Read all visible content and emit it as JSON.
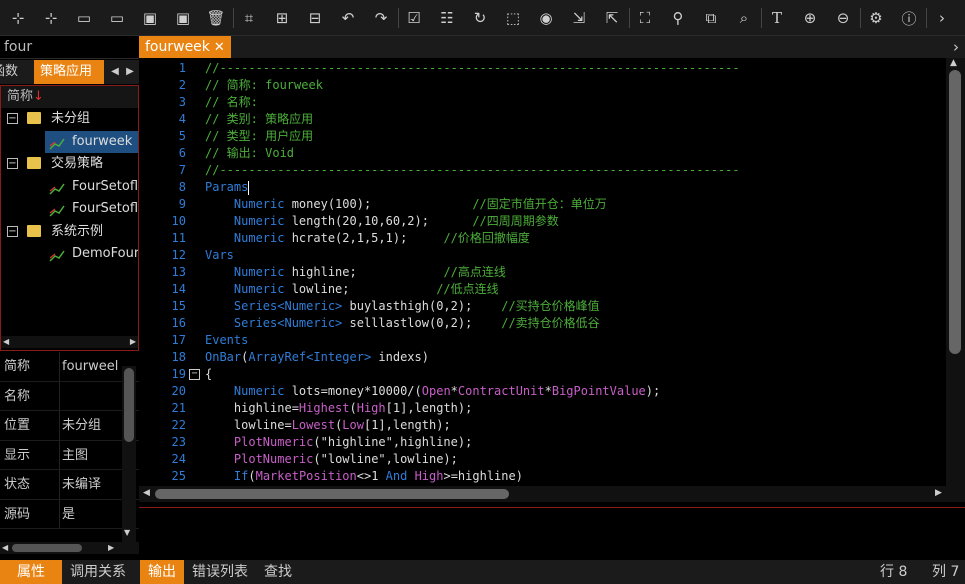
{
  "toolbar": {
    "buttons": [
      "add-node-icon",
      "add-child-icon",
      "folder-icon",
      "open-folder-icon",
      "save-icon",
      "save-all-icon",
      "delete-icon",
      "crop-icon",
      "add-box-icon",
      "copy-box-icon",
      "undo-icon",
      "redo-icon",
      "check-icon",
      "checklist-icon",
      "refresh-icon",
      "selection-icon",
      "record-icon",
      "export-icon",
      "external-icon",
      "fullscreen-icon",
      "search-icon",
      "replace-icon",
      "find-window-icon",
      "text-icon",
      "zoom-in-icon",
      "zoom-out-icon",
      "settings-icon",
      "info-icon",
      "next-icon"
    ]
  },
  "left_panel": {
    "search_value": "four",
    "tabs": [
      "函数",
      "策略应用"
    ],
    "tree_header": "简称",
    "tree": [
      {
        "type": "group",
        "label": "未分组"
      },
      {
        "type": "item",
        "label": "fourweek",
        "selected": true
      },
      {
        "type": "group",
        "label": "交易策略"
      },
      {
        "type": "item",
        "label": "FourSetofl"
      },
      {
        "type": "item",
        "label": "FourSetofl"
      },
      {
        "type": "group",
        "label": "系统示例"
      },
      {
        "type": "item",
        "label": "DemoFour"
      }
    ],
    "props": [
      {
        "k": "简称",
        "v": "fourweel"
      },
      {
        "k": "名称",
        "v": ""
      },
      {
        "k": "位置",
        "v": "未分组"
      },
      {
        "k": "显示",
        "v": "主图"
      },
      {
        "k": "状态",
        "v": "未编译"
      },
      {
        "k": "源码",
        "v": "是"
      }
    ]
  },
  "editor": {
    "tab_label": "fourweek",
    "lines": [
      [
        [
          "c-com",
          "//------------------------------------------------------------------------"
        ]
      ],
      [
        [
          "c-com",
          "// 简称: fourweek"
        ]
      ],
      [
        [
          "c-com",
          "// 名称:"
        ]
      ],
      [
        [
          "c-com",
          "// 类别: 策略应用"
        ]
      ],
      [
        [
          "c-com",
          "// 类型: 用户应用"
        ]
      ],
      [
        [
          "c-com",
          "// 输出: Void"
        ]
      ],
      [
        [
          "c-com",
          "//------------------------------------------------------------------------"
        ]
      ],
      [
        [
          "c-kw",
          "Params"
        ],
        [
          "cursor",
          ""
        ]
      ],
      [
        [
          "c-tx",
          "    "
        ],
        [
          "c-kw",
          "Numeric"
        ],
        [
          "c-tx",
          " money(100);              "
        ],
        [
          "c-com",
          "//固定市值开仓：单位万"
        ]
      ],
      [
        [
          "c-tx",
          "    "
        ],
        [
          "c-kw",
          "Numeric"
        ],
        [
          "c-tx",
          " length(20,10,60,2);      "
        ],
        [
          "c-com",
          "//四周周期参数"
        ]
      ],
      [
        [
          "c-tx",
          "    "
        ],
        [
          "c-kw",
          "Numeric"
        ],
        [
          "c-tx",
          " hcrate(2,1,5,1);     "
        ],
        [
          "c-com",
          "//价格回撤幅度"
        ]
      ],
      [
        [
          "c-kw",
          "Vars"
        ]
      ],
      [
        [
          "c-tx",
          "    "
        ],
        [
          "c-kw",
          "Numeric"
        ],
        [
          "c-tx",
          " highline;            "
        ],
        [
          "c-com",
          "//高点连线"
        ]
      ],
      [
        [
          "c-tx",
          "    "
        ],
        [
          "c-kw",
          "Numeric"
        ],
        [
          "c-tx",
          " lowline;            "
        ],
        [
          "c-com",
          "//低点连线"
        ]
      ],
      [
        [
          "c-tx",
          "    "
        ],
        [
          "c-kw",
          "Series<Numeric>"
        ],
        [
          "c-tx",
          " buylasthigh(0,2);    "
        ],
        [
          "c-com",
          "//买持仓价格峰值"
        ]
      ],
      [
        [
          "c-tx",
          "    "
        ],
        [
          "c-kw",
          "Series<Numeric>"
        ],
        [
          "c-tx",
          " selllastlow(0,2);    "
        ],
        [
          "c-com",
          "//卖持仓价格低谷"
        ]
      ],
      [
        [
          "c-kw",
          "Events"
        ]
      ],
      [
        [
          "c-kw",
          "OnBar"
        ],
        [
          "c-tx",
          "("
        ],
        [
          "c-kw",
          "ArrayRef<Integer>"
        ],
        [
          "c-tx",
          " indexs)"
        ]
      ],
      [
        [
          "c-tx",
          "{"
        ]
      ],
      [
        [
          "c-tx",
          "    "
        ],
        [
          "c-kw",
          "Numeric"
        ],
        [
          "c-tx",
          " lots=money*10000/("
        ],
        [
          "c-fn",
          "Open"
        ],
        [
          "c-tx",
          "*"
        ],
        [
          "c-fn",
          "ContractUnit"
        ],
        [
          "c-tx",
          "*"
        ],
        [
          "c-fn",
          "BigPointValue"
        ],
        [
          "c-tx",
          ");"
        ]
      ],
      [
        [
          "c-tx",
          "    highline="
        ],
        [
          "c-fn",
          "Highest"
        ],
        [
          "c-tx",
          "("
        ],
        [
          "c-fn",
          "High"
        ],
        [
          "c-tx",
          "[1],length);"
        ]
      ],
      [
        [
          "c-tx",
          "    lowline="
        ],
        [
          "c-fn",
          "Lowest"
        ],
        [
          "c-tx",
          "("
        ],
        [
          "c-fn",
          "Low"
        ],
        [
          "c-tx",
          "[1],length);"
        ]
      ],
      [
        [
          "c-tx",
          "    "
        ],
        [
          "c-fn",
          "PlotNumeric"
        ],
        [
          "c-tx",
          "(\"highline\",highline);"
        ]
      ],
      [
        [
          "c-tx",
          "    "
        ],
        [
          "c-fn",
          "PlotNumeric"
        ],
        [
          "c-tx",
          "(\"lowline\",lowline);"
        ]
      ],
      [
        [
          "c-tx",
          "    "
        ],
        [
          "c-kw",
          "If"
        ],
        [
          "c-tx",
          "("
        ],
        [
          "c-fn",
          "MarketPosition"
        ],
        [
          "c-tx",
          "<>1 "
        ],
        [
          "c-kw",
          "And"
        ],
        [
          "c-tx",
          " "
        ],
        [
          "c-fn",
          "High"
        ],
        [
          "c-tx",
          ">=highline)"
        ]
      ]
    ]
  },
  "bottom_tabs": [
    "属性",
    "调用关系",
    "输出",
    "错误列表",
    "查找"
  ],
  "status": {
    "row": "行 8",
    "col": "列 7"
  }
}
